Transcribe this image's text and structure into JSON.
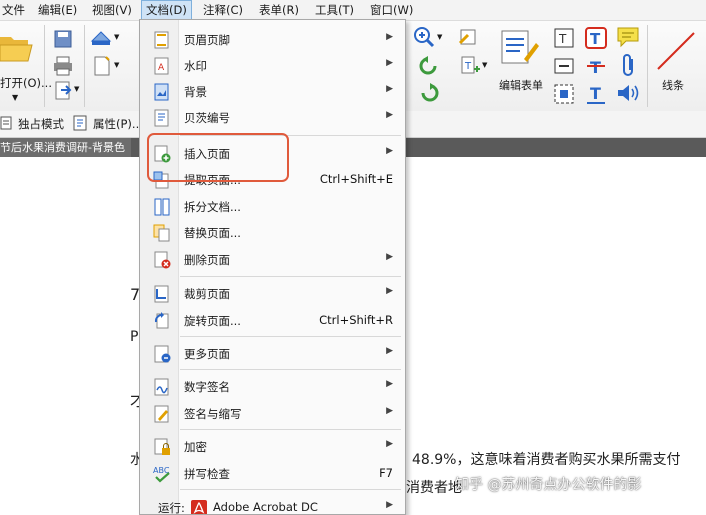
{
  "menubar": {
    "items": [
      {
        "label": "文件"
      },
      {
        "label": "编辑(E)"
      },
      {
        "label": "视图(V)"
      },
      {
        "label": "文档(D)",
        "active": true
      },
      {
        "label": "注释(C)"
      },
      {
        "label": "表单(R)"
      },
      {
        "label": "工具(T)"
      },
      {
        "label": "窗口(W)"
      }
    ]
  },
  "ribbon": {
    "open_label": "打开(O)...",
    "exclusive_mode_label": "独占模式",
    "properties_label": "属性(P)...",
    "edit_form_label": "编辑表单",
    "lines_label": "线条"
  },
  "document": {
    "tab_title": "节后水果消费调研-背景色",
    "fragments": [
      {
        "id": "frag1",
        "text": "7"
      },
      {
        "id": "frag2",
        "text": "P"
      },
      {
        "id": "frag3",
        "text": "才"
      },
      {
        "id": "frag4",
        "text": "水"
      },
      {
        "id": "frag5",
        "text": "48.9%，这意味着消费者购买水果所需支付"
      },
      {
        "id": "frag6",
        "text": "消费者地"
      }
    ],
    "watermark": "知乎 @苏州奇点办公软件的影"
  },
  "doc_menu": {
    "items": [
      {
        "label": "页眉页脚",
        "arrow": true,
        "icon": "header-footer-icon"
      },
      {
        "label": "水印",
        "arrow": true,
        "icon": "watermark-icon"
      },
      {
        "label": "背景",
        "arrow": true,
        "icon": "background-icon"
      },
      {
        "label": "贝茨编号",
        "arrow": true,
        "icon": "bates-numbering-icon"
      },
      {
        "label": "插入页面",
        "arrow": true,
        "icon": "insert-page-icon"
      },
      {
        "label": "提取页面...",
        "shortcut": "Ctrl+Shift+E",
        "icon": "extract-page-icon"
      },
      {
        "label": "拆分文档...",
        "icon": "split-document-icon"
      },
      {
        "label": "替换页面...",
        "icon": "replace-page-icon"
      },
      {
        "label": "删除页面",
        "arrow": true,
        "icon": "delete-page-icon"
      },
      {
        "label": "裁剪页面",
        "arrow": true,
        "icon": "crop-page-icon"
      },
      {
        "label": "旋转页面...",
        "shortcut": "Ctrl+Shift+R",
        "icon": "rotate-page-icon"
      },
      {
        "label": "更多页面",
        "arrow": true,
        "icon": "more-pages-icon"
      },
      {
        "label": "数字签名",
        "arrow": true,
        "icon": "digital-signature-icon"
      },
      {
        "label": "签名与缩写",
        "arrow": true,
        "icon": "sign-initials-icon"
      },
      {
        "label": "加密",
        "arrow": true,
        "icon": "encrypt-icon"
      },
      {
        "label": "拼写检查",
        "shortcut": "F7",
        "icon": "spell-check-icon"
      },
      {
        "label": "运行: ",
        "sublabel": "Adobe Acrobat DC",
        "arrow": true,
        "icon": "acrobat-icon"
      }
    ]
  },
  "colors": {
    "highlight": "#e05a3c",
    "menu_bg": "#fafafa",
    "tab_bg": "#5a5a5a",
    "acrobat_red": "#d42c1e",
    "ribbon_blue": "#2a66c6"
  }
}
